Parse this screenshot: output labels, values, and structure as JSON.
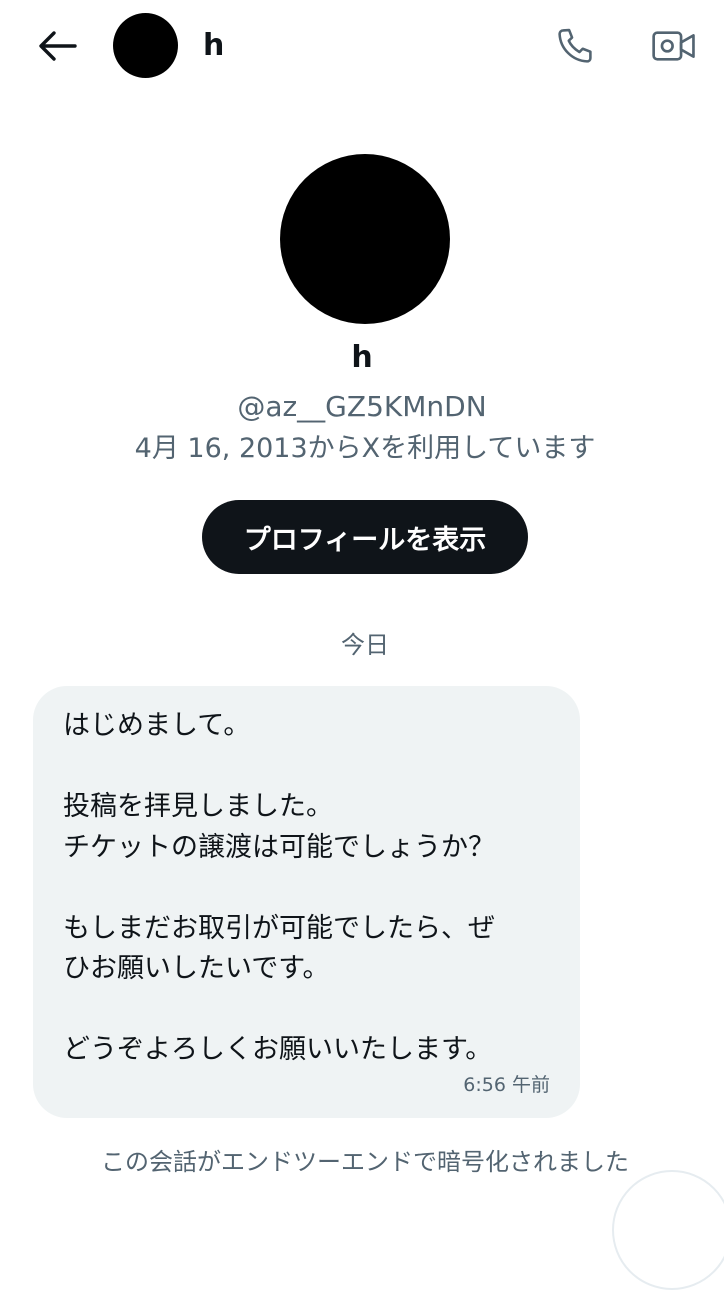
{
  "header": {
    "name": "h",
    "back_icon": "arrow-left-icon",
    "call_icon": "phone-icon",
    "video_icon": "video-camera-icon"
  },
  "profile": {
    "name": "h",
    "handle": "@az__GZ5KMnDN",
    "joined": "4月 16, 2013からXを利用しています",
    "view_profile_label": "プロフィールを表示"
  },
  "conversation": {
    "date_label": "今日",
    "message": {
      "lines": [
        "はじめまして。",
        "",
        "投稿を拝見しました。",
        "チケットの譲渡は可能でしょうか？",
        "",
        "もしまだお取引が可能でしたら、ぜ",
        "ひお願いしたいです。",
        "",
        "どうぞよろしくお願いいたします。"
      ],
      "time": "6:56 午前"
    },
    "encryption_note": "この会話がエンドツーエンドで暗号化されました"
  },
  "colors": {
    "text_primary": "#0f1419",
    "text_secondary": "#536471",
    "bubble_bg": "#eff3f4",
    "button_bg": "#0f1419"
  }
}
